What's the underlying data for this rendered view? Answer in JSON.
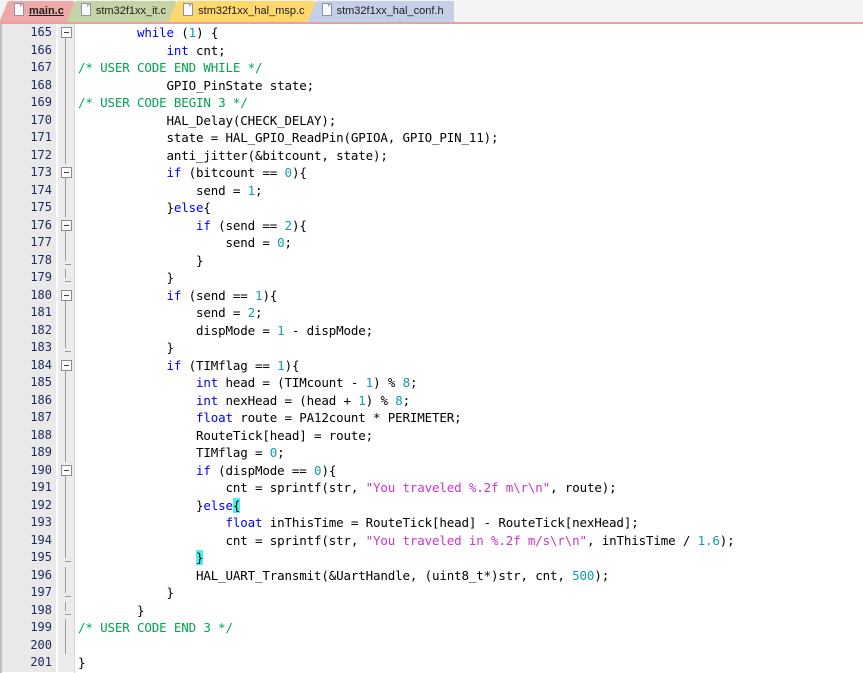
{
  "tabs": [
    {
      "label": "main.c",
      "color": "c-red",
      "active": true
    },
    {
      "label": "stm32f1xx_it.c",
      "color": "c-green",
      "active": false
    },
    {
      "label": "stm32f1xx_hal_msp.c",
      "color": "c-yellow",
      "active": false
    },
    {
      "label": "stm32f1xx_hal_conf.h",
      "color": "c-blue",
      "active": false
    }
  ],
  "colors": {
    "keyword": "#0000ff",
    "number": "#0f9ea8",
    "string": "#cc33cc",
    "comment": "#00a550",
    "brace_highlight": "#4df0f0",
    "gutter_bg": "#e9e9e9",
    "line_number": "#1b2a5e",
    "editor_bg": "#ffffff",
    "tab_active": "#efa8a8",
    "tab_green": "#c5d4a5",
    "tab_yellow": "#ffd86b",
    "tab_blue": "#c5cfe8"
  },
  "editor": {
    "first_line": 165,
    "last_line": 201,
    "lines": [
      {
        "n": 165,
        "fold": "open",
        "text": "        while (1) {"
      },
      {
        "n": 166,
        "fold": "line",
        "text": "            int cnt;"
      },
      {
        "n": 167,
        "fold": "line",
        "text": "/* USER CODE END WHILE */"
      },
      {
        "n": 168,
        "fold": "line",
        "text": "            GPIO_PinState state;"
      },
      {
        "n": 169,
        "fold": "line",
        "text": "/* USER CODE BEGIN 3 */"
      },
      {
        "n": 170,
        "fold": "line",
        "text": "            HAL_Delay(CHECK_DELAY);"
      },
      {
        "n": 171,
        "fold": "line",
        "text": "            state = HAL_GPIO_ReadPin(GPIOA, GPIO_PIN_11);"
      },
      {
        "n": 172,
        "fold": "line",
        "text": "            anti_jitter(&bitcount, state);"
      },
      {
        "n": 173,
        "fold": "open",
        "text": "            if (bitcount == 0){"
      },
      {
        "n": 174,
        "fold": "line",
        "text": "                send = 1;"
      },
      {
        "n": 175,
        "fold": "line",
        "text": "            }else{"
      },
      {
        "n": 176,
        "fold": "open",
        "text": "                if (send == 2){"
      },
      {
        "n": 177,
        "fold": "line",
        "text": "                    send = 0;"
      },
      {
        "n": 178,
        "fold": "end",
        "text": "                }"
      },
      {
        "n": 179,
        "fold": "end",
        "text": "            }"
      },
      {
        "n": 180,
        "fold": "open",
        "text": "            if (send == 1){"
      },
      {
        "n": 181,
        "fold": "line",
        "text": "                send = 2;"
      },
      {
        "n": 182,
        "fold": "line",
        "text": "                dispMode = 1 - dispMode;"
      },
      {
        "n": 183,
        "fold": "end",
        "text": "            }"
      },
      {
        "n": 184,
        "fold": "open",
        "text": "            if (TIMflag == 1){"
      },
      {
        "n": 185,
        "fold": "line",
        "text": "                int head = (TIMcount - 1) % 8;"
      },
      {
        "n": 186,
        "fold": "line",
        "text": "                int nexHead = (head + 1) % 8;"
      },
      {
        "n": 187,
        "fold": "line",
        "text": "                float route = PA12count * PERIMETER;"
      },
      {
        "n": 188,
        "fold": "line",
        "text": "                RouteTick[head] = route;"
      },
      {
        "n": 189,
        "fold": "line",
        "text": "                TIMflag = 0;"
      },
      {
        "n": 190,
        "fold": "open",
        "text": "                if (dispMode == 0){"
      },
      {
        "n": 191,
        "fold": "line",
        "text": "                    cnt = sprintf(str, \"You traveled %.2f m\\r\\n\", route);"
      },
      {
        "n": 192,
        "fold": "line",
        "text": "                }else{"
      },
      {
        "n": 193,
        "fold": "line",
        "text": "                    float inThisTime = RouteTick[head] - RouteTick[nexHead];"
      },
      {
        "n": 194,
        "fold": "line",
        "text": "                    cnt = sprintf(str, \"You traveled in %.2f m/s\\r\\n\", inThisTime / 1.6);"
      },
      {
        "n": 195,
        "fold": "end",
        "text": "                }"
      },
      {
        "n": 196,
        "fold": "line",
        "text": "                HAL_UART_Transmit(&UartHandle, (uint8_t*)str, cnt, 500);"
      },
      {
        "n": 197,
        "fold": "end",
        "text": "            }"
      },
      {
        "n": 198,
        "fold": "end",
        "text": "        }"
      },
      {
        "n": 199,
        "fold": "line",
        "text": "/* USER CODE END 3 */"
      },
      {
        "n": 200,
        "fold": "line",
        "text": ""
      },
      {
        "n": 201,
        "fold": "none",
        "text": "}"
      }
    ],
    "tokens": {
      "keywords": [
        "while",
        "int",
        "if",
        "else",
        "float"
      ],
      "comments": [
        "/* USER CODE END WHILE */",
        "/* USER CODE BEGIN 3 */",
        "/* USER CODE END 3 */"
      ],
      "strings": [
        "\"You traveled %.2f m\\r\\n\"",
        "\"You traveled in %.2f m/s\\r\\n\""
      ],
      "numbers": [
        "0",
        "1",
        "2",
        "8",
        "1.6",
        "500",
        "11",
        "12",
        "2"
      ],
      "highlighted_braces": [
        "{ on line 192",
        "} on line 195"
      ]
    }
  }
}
